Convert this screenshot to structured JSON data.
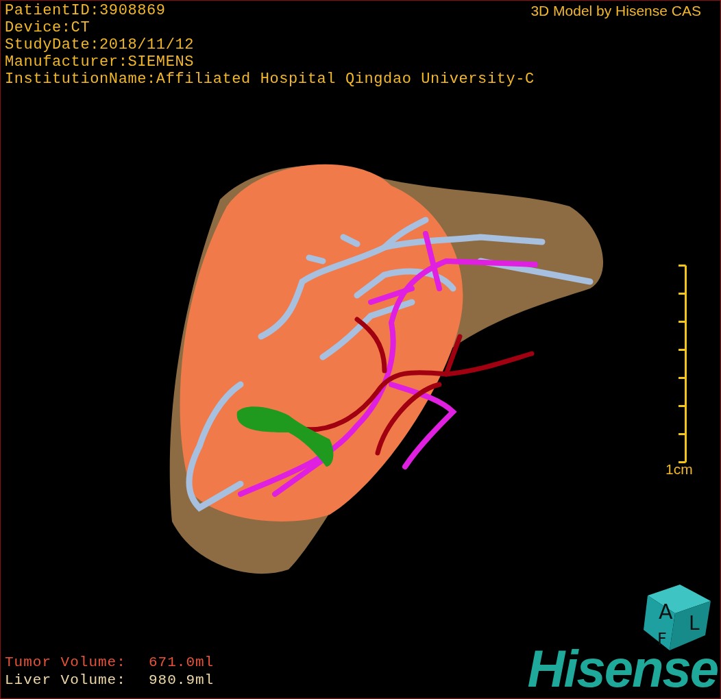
{
  "patient_info": [
    "PatientID:3908869",
    "Device:CT",
    "StudyDate:2018/11/12",
    "Manufacturer:SIEMENS",
    "InstitutionName:Affiliated Hospital Qingdao University-C"
  ],
  "model_credit": "3D Model by Hisense CAS",
  "scale_bar": {
    "label": "1cm"
  },
  "orientation_cube": {
    "faces": [
      "A",
      "L",
      "F"
    ]
  },
  "volumes": [
    {
      "label": "Tumor Volume:",
      "value": "671.0ml",
      "color": "#e8533a"
    },
    {
      "label": "Liver Volume:",
      "value": "980.9ml",
      "color": "#f0d9a8"
    }
  ],
  "logo": "Hisense"
}
